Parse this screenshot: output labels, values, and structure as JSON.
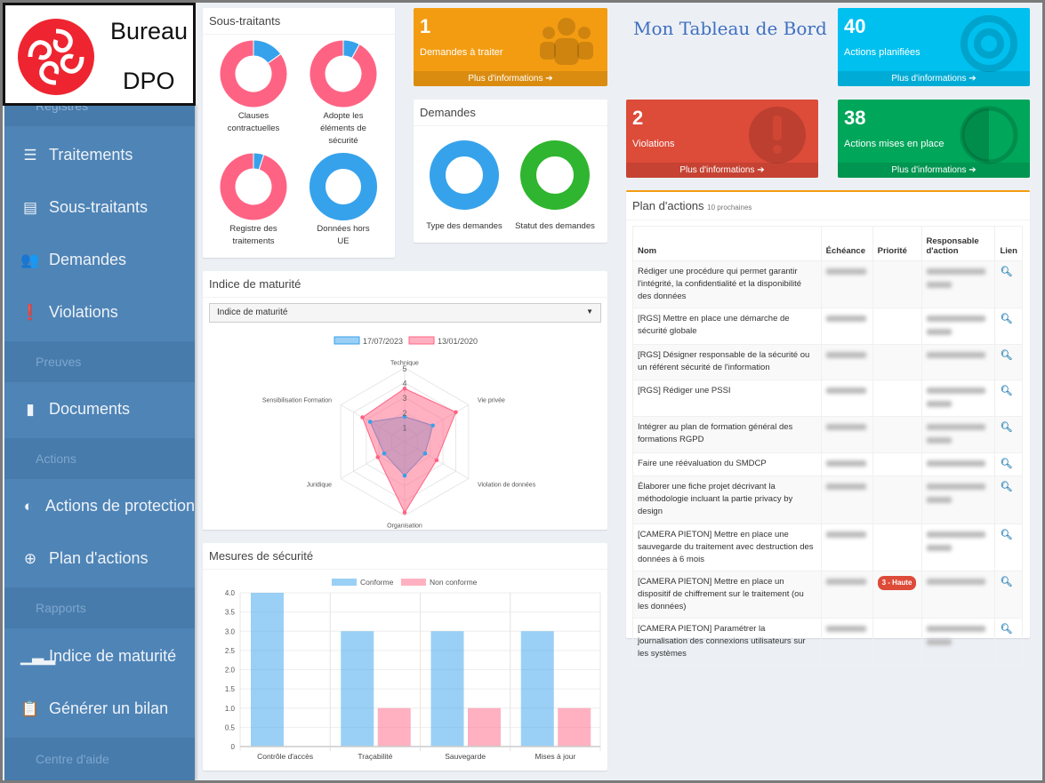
{
  "logo": {
    "line1": "Bureau",
    "line2": "DPO"
  },
  "sidebar": {
    "hidden_header": "Registres",
    "items": [
      {
        "label": "Traitements",
        "icon": "list-icon"
      },
      {
        "label": "Sous-traitants",
        "icon": "id-card-icon"
      },
      {
        "label": "Demandes",
        "icon": "users-icon"
      },
      {
        "label": "Violations",
        "icon": "exclamation-circle-icon"
      },
      {
        "label": "Documents",
        "icon": "file-icon"
      },
      {
        "label": "Actions de protection",
        "icon": "adjust-icon"
      },
      {
        "label": "Plan d'actions",
        "icon": "crosshairs-icon"
      },
      {
        "label": "Indice de maturité",
        "icon": "bar-chart-icon"
      },
      {
        "label": "Générer un bilan",
        "icon": "clipboard-icon"
      }
    ],
    "headers": [
      "Preuves",
      "Actions",
      "Rapports",
      "Centre d'aide"
    ]
  },
  "page_title": "Mon Tableau de Bord",
  "cards": [
    {
      "value": "1",
      "label": "Demandes à traiter",
      "more": "Plus d'informations",
      "color": "#f39c12",
      "icon": "users-icon"
    },
    {
      "value": "40",
      "label": "Actions planifiées",
      "more": "Plus d'informations",
      "color": "#00c0ef",
      "icon": "bullseye-icon"
    },
    {
      "value": "2",
      "label": "Violations",
      "more": "Plus d'informations",
      "color": "#dd4b39",
      "icon": "exclamation-icon"
    },
    {
      "value": "38",
      "label": "Actions mises en place",
      "more": "Plus d'informations",
      "color": "#00a65a",
      "icon": "adjust-icon"
    }
  ],
  "sous_traitants": {
    "title": "Sous-traitants"
  },
  "demandes": {
    "title": "Demandes"
  },
  "maturite": {
    "title": "Indice de maturité",
    "select_value": "Indice de maturité"
  },
  "mesures": {
    "title": "Mesures de sécurité"
  },
  "plan": {
    "title": "Plan d'actions",
    "subtitle": "10 prochaines",
    "columns": [
      "Nom",
      "Échéance",
      "Priorité",
      "Responsable d'action",
      "Lien"
    ],
    "rows": [
      {
        "nom": "Rédiger une procédure qui permet garantir l'intégrité, la confidentialité et la disponibilité des données",
        "priorite": ""
      },
      {
        "nom": "[RGS] Mettre en place une démarche de sécurité globale",
        "priorite": ""
      },
      {
        "nom": "[RGS] Désigner responsable de la sécurité ou un référent sécurité de l'information",
        "priorite": ""
      },
      {
        "nom": "[RGS] Rédiger une PSSI",
        "priorite": ""
      },
      {
        "nom": "Intégrer au plan de formation général des formations RGPD",
        "priorite": ""
      },
      {
        "nom": "Faire une réévaluation du SMDCP",
        "priorite": ""
      },
      {
        "nom": "Élaborer une fiche projet décrivant la méthodologie incluant la partie privacy by design",
        "priorite": ""
      },
      {
        "nom": "[CAMERA PIETON] Mettre en place une sauvegarde du traitement avec destruction des données à 6 mois",
        "priorite": ""
      },
      {
        "nom": "[CAMERA PIETON] Mettre en place un dispositif de chiffrement sur le traitement (ou les données)",
        "priorite": "3 - Haute"
      },
      {
        "nom": "[CAMERA PIETON] Paramétrer la journalisation des connexions utilisateurs sur les systèmes",
        "priorite": ""
      }
    ]
  },
  "chart_data": [
    {
      "type": "pie",
      "variant": "doughnut",
      "panel": "Sous-traitants",
      "charts": [
        {
          "label": "Clauses contractuelles",
          "slices": [
            {
              "color": "#36a2eb",
              "value": 15
            },
            {
              "color": "#ff6384",
              "value": 85
            }
          ]
        },
        {
          "label": "Adopte les éléments de sécurité",
          "slices": [
            {
              "color": "#36a2eb",
              "value": 8
            },
            {
              "color": "#ff6384",
              "value": 92
            }
          ]
        },
        {
          "label": "Registre des traitements",
          "slices": [
            {
              "color": "#36a2eb",
              "value": 5
            },
            {
              "color": "#ff6384",
              "value": 95
            }
          ]
        },
        {
          "label": "Données hors UE",
          "slices": [
            {
              "color": "#36a2eb",
              "value": 100
            }
          ]
        }
      ]
    },
    {
      "type": "pie",
      "variant": "doughnut",
      "panel": "Demandes",
      "charts": [
        {
          "label": "Type des demandes",
          "slices": [
            {
              "color": "#36a2eb",
              "value": 100
            }
          ]
        },
        {
          "label": "Statut des demandes",
          "slices": [
            {
              "color": "#2fb52f",
              "value": 100
            }
          ]
        }
      ]
    },
    {
      "type": "radar",
      "axes": [
        "Technique",
        "Vie privée",
        "Violation de données",
        "Organisation",
        "Juridique",
        "Sensibilisation Formation"
      ],
      "range": [
        0,
        5
      ],
      "ticks": [
        "1",
        "2",
        "3",
        "4",
        "5"
      ],
      "legend": "top",
      "series": [
        {
          "name": "17/07/2023",
          "color": "#36a2eb",
          "values": [
            1.7,
            2.2,
            1.6,
            2.3,
            1.6,
            2.7
          ]
        },
        {
          "name": "13/01/2020",
          "color": "#ff6384",
          "values": [
            3.6,
            4.0,
            2.5,
            4.8,
            2.1,
            3.3
          ]
        }
      ]
    },
    {
      "type": "bar",
      "categories": [
        "Contrôle d'accès",
        "Traçabilité",
        "Sauvegarde",
        "Mises à jour"
      ],
      "ylim": [
        0,
        4
      ],
      "yticks": [
        "0",
        "0.5",
        "1.0",
        "1.5",
        "2.0",
        "2.5",
        "3.0",
        "3.5",
        "4.0"
      ],
      "grid": true,
      "legend": "top",
      "series": [
        {
          "name": "Conforme",
          "color": "#36a2eb",
          "values": [
            4,
            3,
            3,
            3
          ]
        },
        {
          "name": "Non conforme",
          "color": "#ff6384",
          "values": [
            0,
            1,
            1,
            1
          ]
        }
      ]
    }
  ]
}
